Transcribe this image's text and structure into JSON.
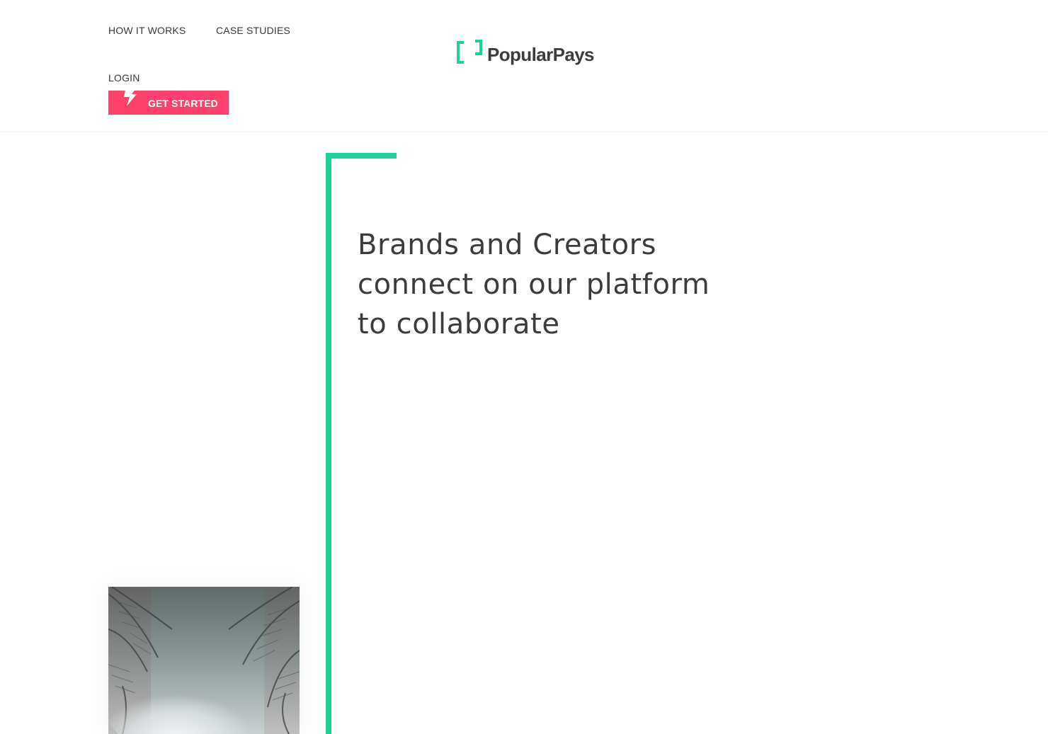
{
  "header": {
    "nav": {
      "how_it_works": "HOW IT WORKS",
      "case_studies": "CASE STUDIES",
      "login": "LOGIN"
    },
    "cta_label": "GET STARTED",
    "logo_text": "PopularPays"
  },
  "hero": {
    "headline_line1": "Brands and Creators",
    "headline_line2": "connect on our platform",
    "headline_line3": "to collaborate"
  },
  "colors": {
    "accent_green": "#1fd19a",
    "cta_pink": "#ff406d",
    "text_dark": "#3c3c3c"
  },
  "icons": {
    "cta_icon": "lightning-bolt-icon",
    "logo_icon": "bracket-logo-icon"
  }
}
